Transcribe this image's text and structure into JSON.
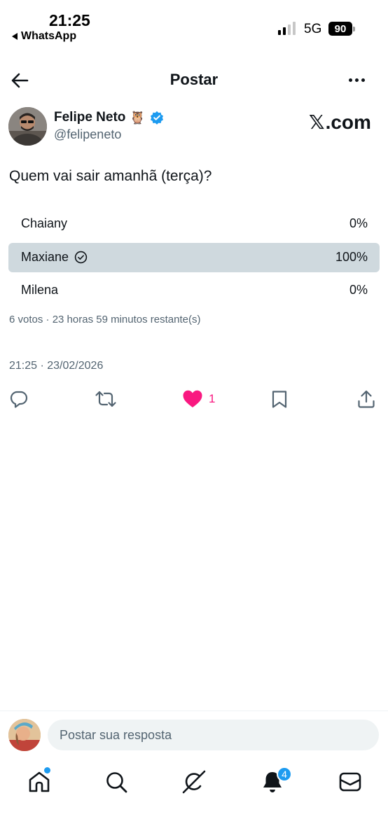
{
  "status_bar": {
    "time": "21:25",
    "back_app": "WhatsApp",
    "network": "5G",
    "battery": "90"
  },
  "header": {
    "title": "Postar"
  },
  "author": {
    "name": "Felipe Neto",
    "emoji": "🦉",
    "handle": "@felipeneto",
    "verified": true
  },
  "watermark": {
    "x_symbol": "𝕏",
    "suffix": ".com"
  },
  "post": {
    "text": "Quem vai sair amanhã (terça)?",
    "poll": [
      {
        "label": "Chaiany",
        "percent_text": "0%",
        "fraction": 0,
        "selected": false
      },
      {
        "label": "Maxiane",
        "percent_text": "100%",
        "fraction": 1,
        "selected": true
      },
      {
        "label": "Milena",
        "percent_text": "0%",
        "fraction": 0,
        "selected": false
      }
    ],
    "poll_meta": "6 votos · 23 horas 59 minutos restante(s)",
    "timestamp": "21:25 · 23/02/2026"
  },
  "actions": {
    "like_count": "1",
    "like_color": "#f91880"
  },
  "reply": {
    "placeholder": "Postar sua resposta"
  },
  "nav": {
    "notifications_badge": "4",
    "accent": "#1d9bf0"
  },
  "icons": [
    "back-arrow-icon",
    "more-icon",
    "verified-icon",
    "reply-icon",
    "retweet-icon",
    "heart-icon",
    "bookmark-icon",
    "share-icon",
    "home-icon",
    "search-icon",
    "grok-icon",
    "bell-icon",
    "mail-icon",
    "check-circle-icon"
  ]
}
